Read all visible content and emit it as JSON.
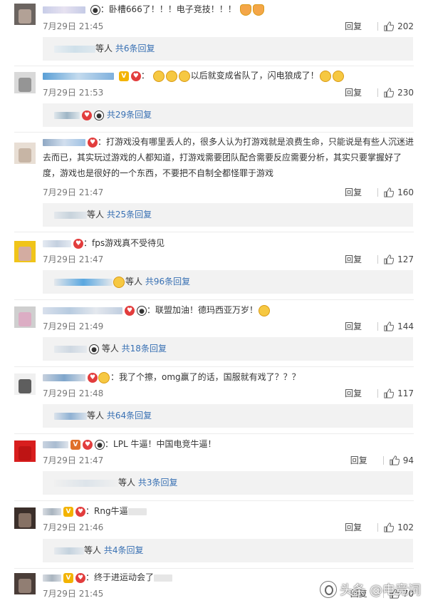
{
  "comments": [
    {
      "text": "卧槽666了！！！电子竞技！！！",
      "time": "7月29日 21:45",
      "reply": "回复",
      "likes": "202",
      "replies": {
        "suffix": "等人",
        "count": "共6条回复"
      }
    },
    {
      "text": "以后就变成省队了，闪电狼成了！",
      "time": "7月29日 21:53",
      "reply": "回复",
      "likes": "230",
      "replies": {
        "suffix": "",
        "count": "共29条回复"
      }
    },
    {
      "text": "打游戏没有哪里丢人的，很多人认为打游戏就是浪费生命，只能说是有些人沉迷进去而已，其实玩过游戏的人都知道，打游戏需要团队配合需要反应需要分析，其实只要掌握好了度，游戏也是很好的一个东西，不要把不自制全都怪罪于游戏",
      "time": "7月29日 21:47",
      "reply": "回复",
      "likes": "160",
      "replies": {
        "suffix": "等人",
        "count": "共25条回复"
      }
    },
    {
      "text": "fps游戏真不受待见",
      "time": "7月29日 21:47",
      "reply": "回复",
      "likes": "127",
      "replies": {
        "suffix": "等人",
        "count": "共96条回复"
      }
    },
    {
      "text": "联盟加油！德玛西亚万岁！",
      "time": "7月29日 21:49",
      "reply": "回复",
      "likes": "144",
      "replies": {
        "suffix": "等人",
        "count": "共18条回复"
      }
    },
    {
      "text": "我了个擦，omg赢了的话，国服就有戏了？？？",
      "time": "7月29日 21:48",
      "reply": "回复",
      "likes": "117",
      "replies": {
        "suffix": "等人",
        "count": "共64条回复"
      }
    },
    {
      "text": "LPL 牛逼！中国电竞牛逼！",
      "time": "7月29日 21:47",
      "reply": "回复",
      "likes": "94",
      "replies": {
        "suffix": "等人",
        "count": "共3条回复"
      }
    },
    {
      "text": "Rng牛逼",
      "time": "7月29日 21:46",
      "reply": "回复",
      "likes": "102",
      "replies": {
        "suffix": "等人",
        "count": "共4条回复"
      }
    },
    {
      "text": "终于进运动会了",
      "time": "7月29日 21:45",
      "reply": "回复",
      "likes": "70",
      "replies": null
    }
  ],
  "colors": {
    "link": "#3870b3",
    "time": "#777777",
    "bar": "#f2f2f2"
  },
  "icons": {
    "like": "thumbs-up-icon",
    "vip": "v-badge-icon"
  },
  "watermark": "头条 @电竞词"
}
